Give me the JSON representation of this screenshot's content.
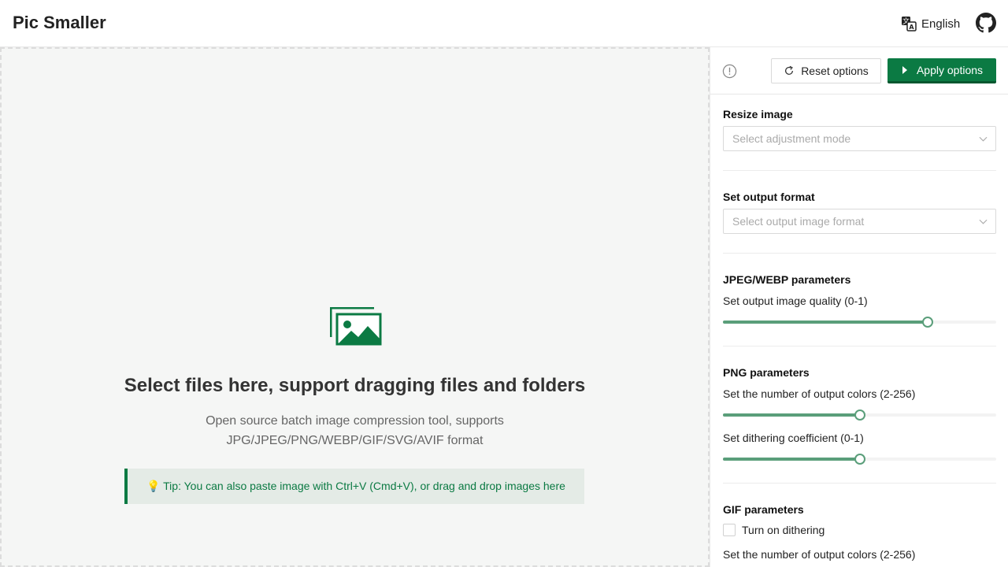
{
  "header": {
    "title": "Pic Smaller",
    "language": "English",
    "icons": {
      "language": "translate-icon",
      "repo": "github-icon"
    }
  },
  "dropzone": {
    "title": "Select files here, support dragging files and folders",
    "desc_line1": "Open source batch image compression tool, supports",
    "desc_line2": "JPG/JPEG/PNG/WEBP/GIF/SVG/AVIF format",
    "tip": "💡 Tip: You can also paste image with Ctrl+V (Cmd+V), or drag and drop images here"
  },
  "toolbar": {
    "reset_label": "Reset options",
    "apply_label": "Apply options"
  },
  "resize": {
    "title": "Resize image",
    "placeholder": "Select adjustment mode"
  },
  "format": {
    "title": "Set output format",
    "placeholder": "Select output image format"
  },
  "jpeg": {
    "title": "JPEG/WEBP parameters",
    "quality_label": "Set output image quality (0-1)",
    "quality_fraction": 0.75
  },
  "png": {
    "title": "PNG parameters",
    "colors_label": "Set the number of output colors (2-256)",
    "colors_fraction": 0.5,
    "dither_label": "Set dithering coefficient (0-1)",
    "dither_fraction": 0.5
  },
  "gif": {
    "title": "GIF parameters",
    "dither_checkbox": "Turn on dithering",
    "dither_checked": false,
    "colors_label": "Set the number of output colors (2-256)"
  },
  "colors": {
    "accent": "#0b7a43",
    "slider": "#5a9e7a",
    "tip_bg": "#e4ebe6"
  }
}
